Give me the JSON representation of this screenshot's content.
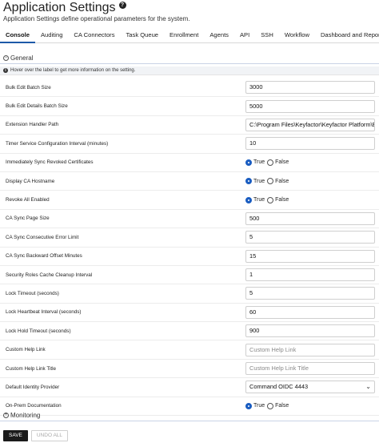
{
  "header": {
    "title": "Application Settings",
    "help_icon": "question-circle-icon",
    "subtitle": "Application Settings define operational parameters for the system."
  },
  "tabs": [
    {
      "label": "Console",
      "active": true
    },
    {
      "label": "Auditing",
      "active": false
    },
    {
      "label": "CA Connectors",
      "active": false
    },
    {
      "label": "Task Queue",
      "active": false
    },
    {
      "label": "Enrollment",
      "active": false
    },
    {
      "label": "Agents",
      "active": false
    },
    {
      "label": "API",
      "active": false
    },
    {
      "label": "SSH",
      "active": false
    },
    {
      "label": "Workflow",
      "active": false
    },
    {
      "label": "Dashboard and Reports",
      "active": false
    }
  ],
  "sections": {
    "general": {
      "label": "General",
      "icon": "collapse-minus-icon"
    },
    "monitoring": {
      "label": "Monitoring",
      "icon": "expand-plus-icon"
    }
  },
  "info": {
    "icon": "info-icon",
    "text": "Hover over the label to get more information on the setting."
  },
  "settings": [
    {
      "key": "bulk-edit-batch-size",
      "label": "Bulk Edit Batch Size",
      "type": "text",
      "value": "3000"
    },
    {
      "key": "bulk-edit-details-batch-size",
      "label": "Bulk Edit Details Batch Size",
      "type": "text",
      "value": "5000"
    },
    {
      "key": "extension-handler-path",
      "label": "Extension Handler Path",
      "type": "text",
      "value": "C:\\Program Files\\Keyfactor\\Keyfactor Platform\\Extensions"
    },
    {
      "key": "timer-service-interval",
      "label": "Timer Service Configuration Interval (minutes)",
      "type": "text",
      "value": "10"
    },
    {
      "key": "sync-revoked-certs",
      "label": "Immediately Sync Revoked Certificates",
      "type": "radio",
      "value": "True"
    },
    {
      "key": "display-ca-hostname",
      "label": "Display CA Hostname",
      "type": "radio",
      "value": "True"
    },
    {
      "key": "revoke-all-enabled",
      "label": "Revoke All Enabled",
      "type": "radio",
      "value": "True"
    },
    {
      "key": "ca-sync-page-size",
      "label": "CA Sync Page Size",
      "type": "text",
      "value": "500"
    },
    {
      "key": "ca-sync-error-limit",
      "label": "CA Sync Consecutive Error Limit",
      "type": "text",
      "value": "5"
    },
    {
      "key": "ca-sync-backward-offset",
      "label": "CA Sync Backward Offset Minutes",
      "type": "text",
      "value": "15"
    },
    {
      "key": "security-roles-cache-cleanup",
      "label": "Security Roles Cache Cleanup Interval",
      "type": "text",
      "value": "1"
    },
    {
      "key": "lock-timeout",
      "label": "Lock Timeout (seconds)",
      "type": "text",
      "value": "5"
    },
    {
      "key": "lock-heartbeat-interval",
      "label": "Lock Heartbeat Interval (seconds)",
      "type": "text",
      "value": "60"
    },
    {
      "key": "lock-hold-timeout",
      "label": "Lock Hold Timeout (seconds)",
      "type": "text",
      "value": "900"
    },
    {
      "key": "custom-help-link",
      "label": "Custom Help Link",
      "type": "text",
      "value": "",
      "placeholder": "Custom Help Link"
    },
    {
      "key": "custom-help-link-title",
      "label": "Custom Help Link Title",
      "type": "text",
      "value": "",
      "placeholder": "Custom Help Link Title"
    },
    {
      "key": "default-identity-provider",
      "label": "Default Identity Provider",
      "type": "select",
      "value": "Command OIDC 4443"
    },
    {
      "key": "on-prem-documentation",
      "label": "On-Prem Documentation",
      "type": "radio",
      "value": "True"
    }
  ],
  "radio_labels": {
    "true": "True",
    "false": "False"
  },
  "buttons": {
    "save": "SAVE",
    "undo_all": "UNDO ALL"
  },
  "colors": {
    "active_tab": "#1e5aa8",
    "radio_checked": "#1a5dc1",
    "save_button": "#1b1b1b"
  }
}
